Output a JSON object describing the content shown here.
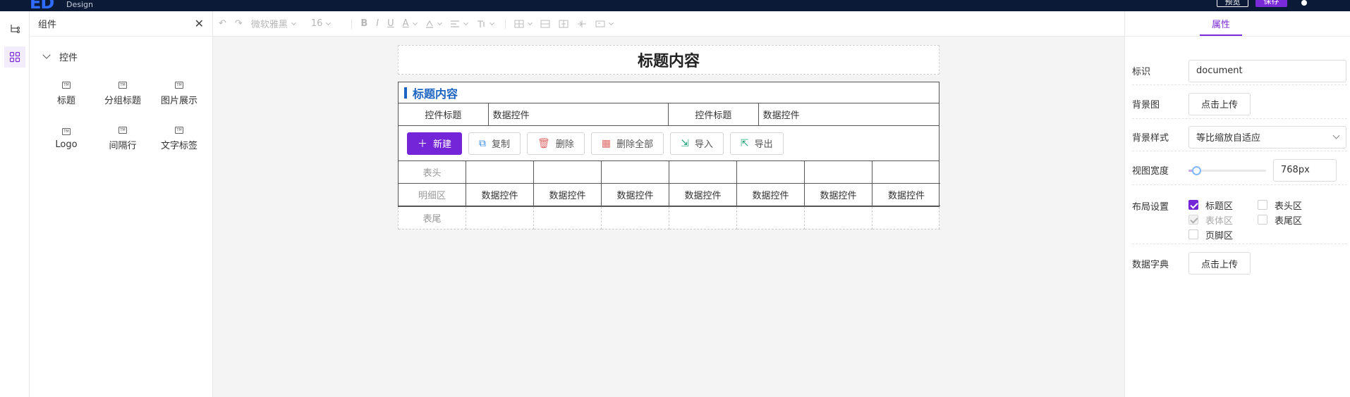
{
  "topbar": {
    "logo_mark": "ED",
    "logo_sub": "Design",
    "preview_label": "预览",
    "save_label": "保存"
  },
  "panel": {
    "title": "组件",
    "close_glyph": "✕",
    "group_label": "控件",
    "items": [
      {
        "label": "标题"
      },
      {
        "label": "分组标题"
      },
      {
        "label": "图片展示"
      },
      {
        "label": "Logo"
      },
      {
        "label": "间隔行"
      },
      {
        "label": "文字标签"
      }
    ]
  },
  "toolbar": {
    "undo": "↶",
    "redo": "↷",
    "font_family": "微软雅黑",
    "font_size": "16",
    "bold": "B",
    "italic": "I",
    "underline": "U",
    "font_color": "A"
  },
  "canvas": {
    "title": "标题内容",
    "section_title": "标题内容",
    "field1_label": "控件标题",
    "field1_value": "数据控件",
    "field2_label": "控件标题",
    "field2_value": "数据控件",
    "actions": {
      "new": "新建",
      "copy": "复制",
      "delete": "删除",
      "delete_all": "删除全部",
      "import": "导入",
      "export": "导出"
    },
    "row_header": "表头",
    "row_detail": "明细区",
    "row_footer": "表尾",
    "cell": "数据控件"
  },
  "props": {
    "tab": "属性",
    "id_label": "标识",
    "id_value": "document",
    "bg_label": "背景图",
    "upload_label": "点击上传",
    "bg_style_label": "背景样式",
    "bg_style_value": "等比缩放自适应",
    "view_width_label": "视图宽度",
    "view_width_value": "768px",
    "view_width_fraction": 0.05,
    "layout_label": "布局设置",
    "layout": {
      "title_area": "标题区",
      "header_area": "表头区",
      "body_area": "表体区",
      "footer_area": "表尾区",
      "page_footer": "页脚区"
    },
    "dict_label": "数据字典",
    "dict_upload": "点击上传"
  },
  "colors": {
    "accent": "#7525d8",
    "section_blue": "#1c64c2",
    "topbar": "#0b1a36"
  }
}
